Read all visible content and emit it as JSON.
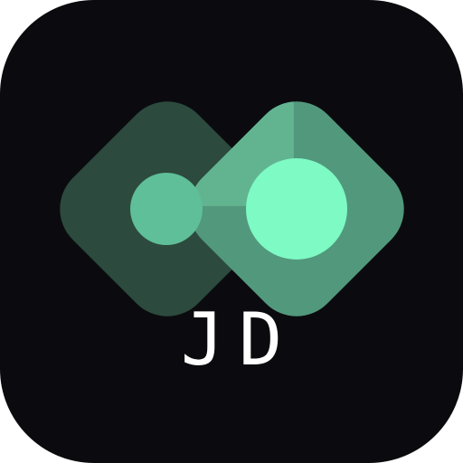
{
  "app_icon": {
    "monogram": "JD",
    "colors": {
      "background": "#0b0b0f",
      "left_diamond": "#2c4a3e",
      "right_diamond": "#52987d",
      "overlap": "#62b491",
      "small_dot": "#5fbf98",
      "large_dot": "#7efac4",
      "monogram_text": "#ffffff"
    }
  }
}
